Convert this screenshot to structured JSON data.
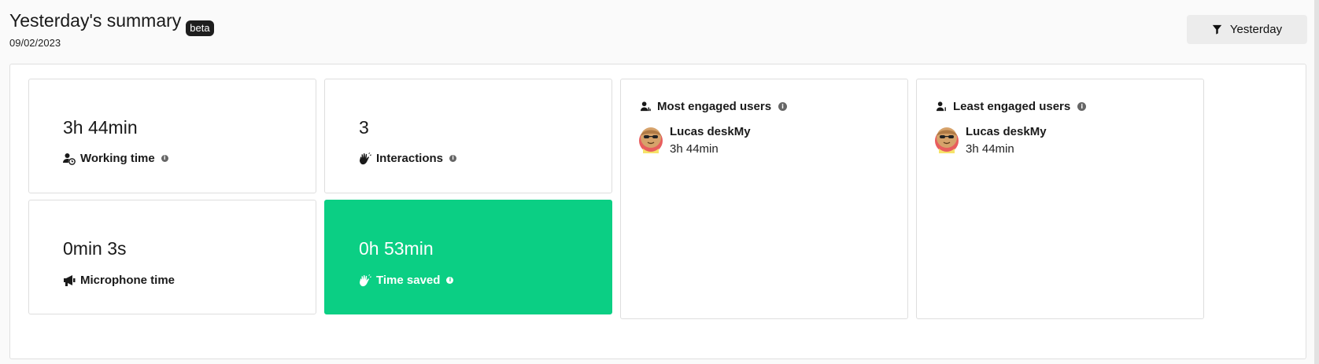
{
  "header": {
    "title": "Yesterday's summary",
    "badge": "beta",
    "date": "09/02/2023",
    "filter_label": "Yesterday"
  },
  "stats": {
    "working_time": {
      "value": "3h 44min",
      "label": "Working time"
    },
    "interactions": {
      "value": "3",
      "label": "Interactions"
    },
    "microphone_time": {
      "value": "0min 3s",
      "label": "Microphone time"
    },
    "time_saved": {
      "value": "0h 53min",
      "label": "Time saved"
    }
  },
  "most_engaged": {
    "title": "Most engaged users",
    "users": [
      {
        "name": "Lucas deskMy",
        "time": "3h 44min"
      }
    ]
  },
  "least_engaged": {
    "title": "Least engaged users",
    "users": [
      {
        "name": "Lucas deskMy",
        "time": "3h 44min"
      }
    ]
  },
  "colors": {
    "accent_green": "#0bcf84",
    "badge_bg": "#1e1e1e",
    "button_bg": "#ececec"
  },
  "icons": {
    "filter": "filter-icon",
    "working_time": "user-clock-icon",
    "interactions": "waving-hand-icon",
    "microphone": "megaphone-icon",
    "time_saved": "waving-hand-icon",
    "users": "user-icon",
    "info": "info-icon"
  }
}
